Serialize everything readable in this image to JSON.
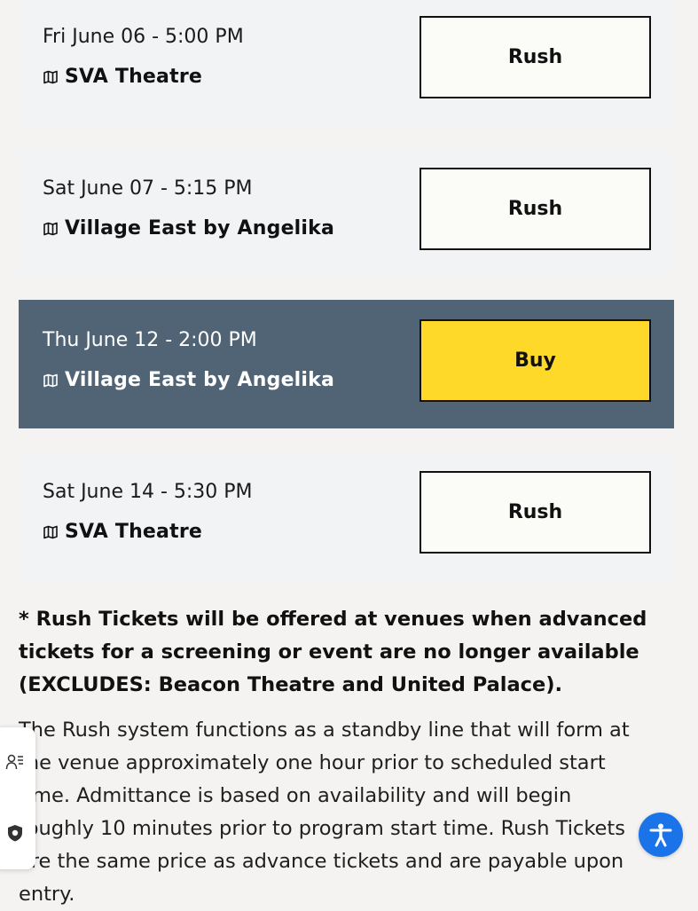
{
  "showtimes": [
    {
      "datetime": "Fri June 06 - 5:00 PM",
      "venue": "SVA Theatre",
      "button": "Rush",
      "highlighted": false
    },
    {
      "datetime": "Sat June 07 - 5:15 PM",
      "venue": "Village East by Angelika",
      "button": "Rush",
      "highlighted": false
    },
    {
      "datetime": "Thu June 12 - 2:00 PM",
      "venue": "Village East by Angelika",
      "button": "Buy",
      "highlighted": true
    },
    {
      "datetime": "Sat June 14 - 5:30 PM",
      "venue": "SVA Theatre",
      "button": "Rush",
      "highlighted": false
    }
  ],
  "rush_notice": "* Rush Tickets will be offered at venues when advanced tickets for a screening or event are no longer available (EXCLUDES: Beacon Theatre and United Palace).",
  "rush_description": "The Rush system functions as a standby line that will form at the venue approximately one hour prior to scheduled start time. Admittance is based on availability and will begin roughly 10 minutes prior to program start time. Rush Tickets are the same price as advance tickets and are payable upon entry.",
  "icons": {
    "venue": "map-icon",
    "side_widget_top": "user-list-icon",
    "side_widget_bottom": "shield-icon",
    "accessibility": "accessibility-icon"
  },
  "colors": {
    "card_bg": "#f2f3f5",
    "highlight_bg": "#506476",
    "buy_button": "#ffd92a",
    "rush_button": "#fbfbf7",
    "accessibility_button": "#1a73e8"
  }
}
